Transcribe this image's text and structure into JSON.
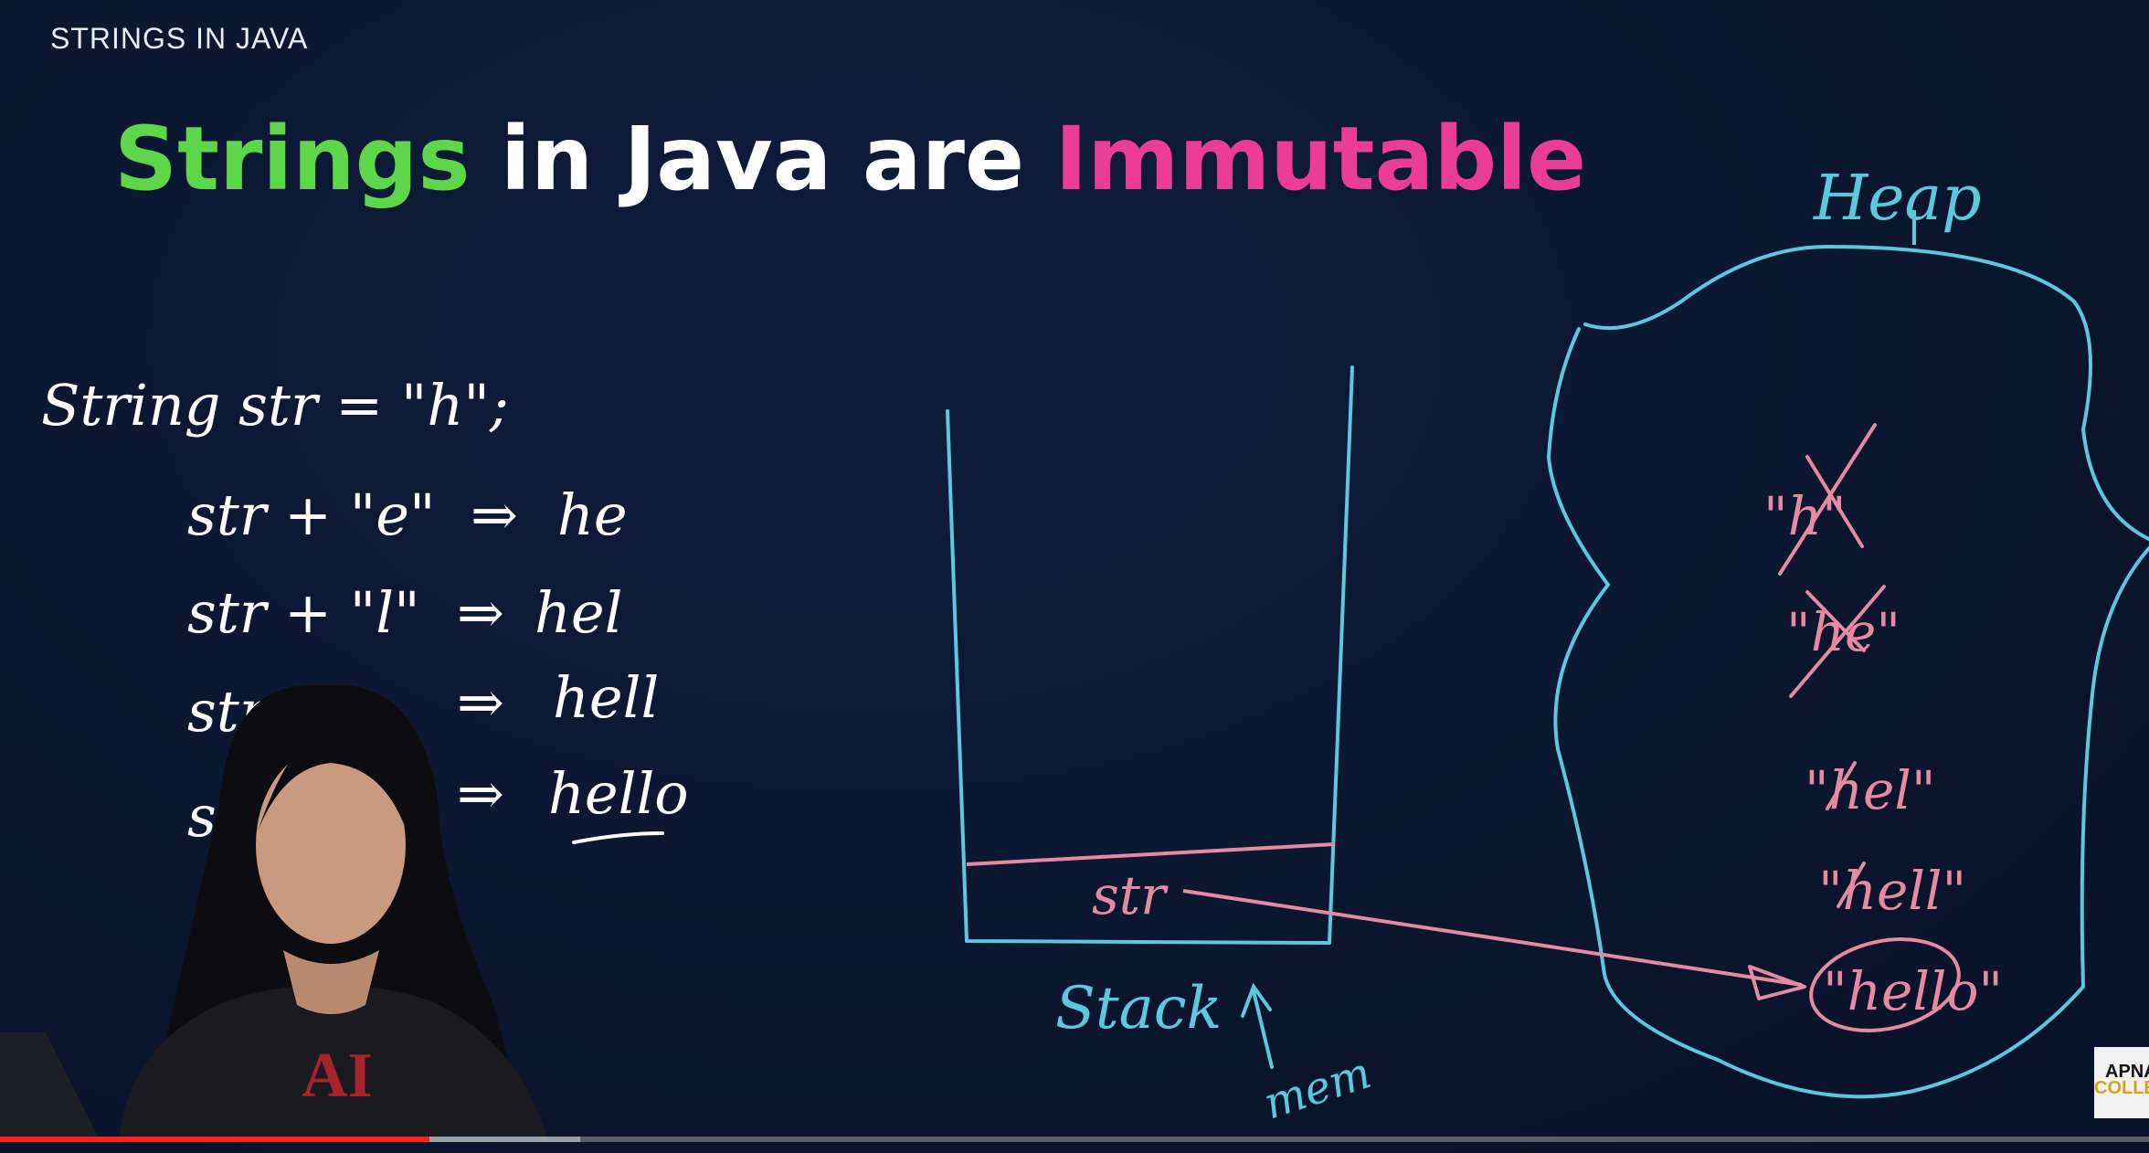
{
  "header": {
    "section_label": "STRINGS IN JAVA"
  },
  "title": {
    "word1": "Strings",
    "word2": " in Java are ",
    "word3": "Immutable",
    "colors": {
      "word1": "#5ed64a",
      "word2": "#ffffff",
      "word3": "#ec3d96"
    }
  },
  "code_notes": {
    "declaration": "String str = \"h\";",
    "steps": [
      {
        "expr": "str + \"e\"",
        "arrow": "⇒",
        "result": "he"
      },
      {
        "expr": "str + \"l\"",
        "arrow": "⇒",
        "result": "hel"
      },
      {
        "expr": "str +",
        "arrow": "⇒",
        "result": "hell"
      },
      {
        "expr": "str",
        "arrow": "⇒",
        "result": "hello"
      }
    ]
  },
  "memory_diagram": {
    "stack_label": "Stack",
    "stack_variable": "str",
    "mem_label": "mem",
    "heap_label": "Heap",
    "heap_objects": [
      {
        "text": "\"h\"",
        "crossed": true
      },
      {
        "text": "\"he\"",
        "crossed": true
      },
      {
        "text": "\"hel\"",
        "crossed": true
      },
      {
        "text": "\"hell\"",
        "crossed": true
      },
      {
        "text": "\"hello\"",
        "crossed": false,
        "circled": true
      }
    ],
    "colors": {
      "container": "#5cc8dc",
      "pointer": "#e58aa0",
      "ink": "#ffffff"
    }
  },
  "logo": {
    "line1": "APNA",
    "line2": "COLLEGE"
  },
  "video": {
    "progress": 0.2,
    "buffered": 0.27,
    "colors": {
      "played": "#ff1f1f",
      "buffered": "#9aa0aa",
      "track": "#5a5f6b"
    }
  }
}
